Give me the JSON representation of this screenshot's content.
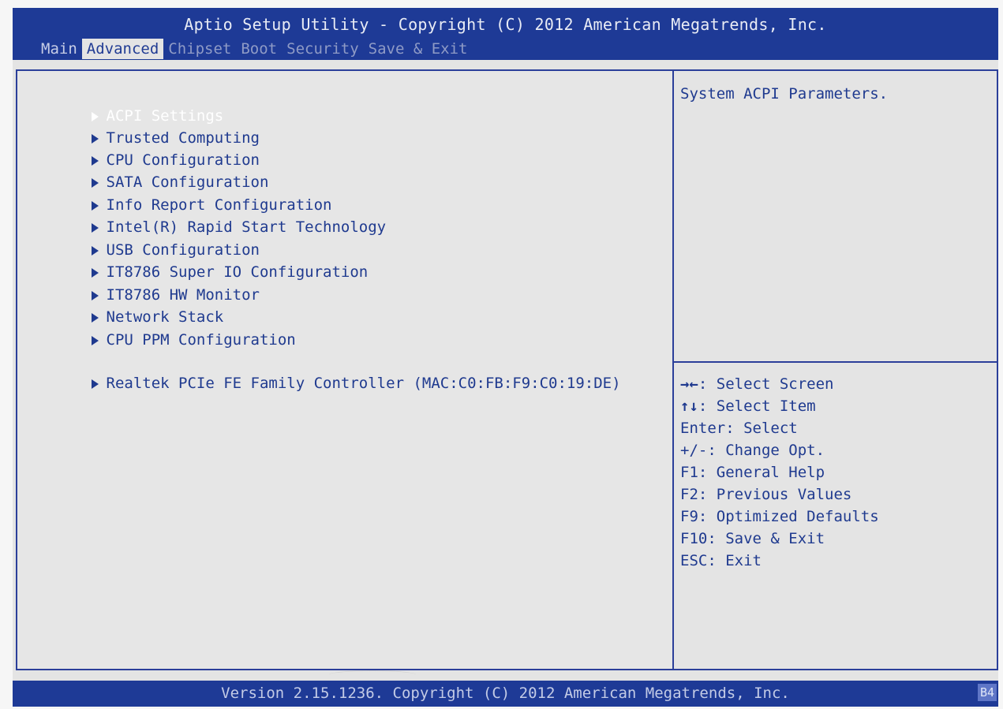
{
  "header": {
    "title": "Aptio Setup Utility - Copyright (C) 2012 American Megatrends, Inc.",
    "tabs": [
      "Main",
      "Advanced",
      "Chipset",
      "Boot",
      "Security",
      "Save & Exit"
    ],
    "active_tab": "Advanced"
  },
  "menu": {
    "items": [
      "ACPI Settings",
      "Trusted Computing",
      "CPU Configuration",
      "SATA Configuration",
      "Info Report Configuration",
      "Intel(R) Rapid Start Technology",
      "USB Configuration",
      "IT8786 Super IO Configuration",
      "IT8786 HW Monitor",
      "Network Stack",
      "CPU PPM Configuration",
      "Realtek PCIe FE Family Controller (MAC:C0:FB:F9:C0:19:DE)"
    ],
    "selected": "ACPI Settings"
  },
  "help": {
    "description": "System ACPI Parameters.",
    "keys": [
      {
        "key": "→←",
        "desc": ": Select Screen"
      },
      {
        "key": "↑↓",
        "desc": ": Select Item"
      },
      {
        "key": "",
        "desc": "Enter: Select"
      },
      {
        "key": "",
        "desc": "+/-: Change Opt."
      },
      {
        "key": "",
        "desc": "F1: General Help"
      },
      {
        "key": "",
        "desc": "F2: Previous Values"
      },
      {
        "key": "",
        "desc": "F9: Optimized Defaults"
      },
      {
        "key": "",
        "desc": "F10: Save & Exit"
      },
      {
        "key": "",
        "desc": "ESC: Exit"
      }
    ]
  },
  "footer": {
    "version": "Version 2.15.1236. Copyright (C) 2012 American Megatrends, Inc.",
    "code": "B4"
  },
  "colors": {
    "bar_blue": "#1e3a96",
    "text_blue": "#1f3a8f",
    "background": "#e4e4e4",
    "selected_text": "#ffffff"
  }
}
